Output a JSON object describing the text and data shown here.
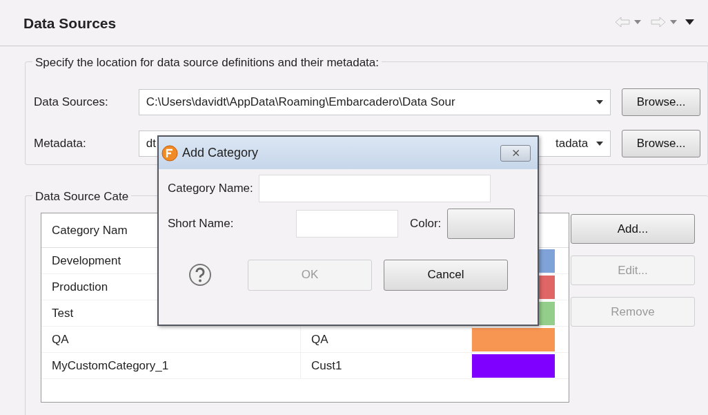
{
  "view": {
    "title": "Data Sources"
  },
  "locations": {
    "legend": "Specify the location for data source definitions and their metadata:",
    "fields": [
      {
        "label": "Data Sources:",
        "value_start": "C:\\Users\\davidt\\AppData\\Roaming\\Embarcadero\\Data Sour",
        "button": "Browse..."
      },
      {
        "label": "Metadata:",
        "value_start": "dt",
        "value_end": "tadata",
        "button": "Browse..."
      }
    ]
  },
  "categories": {
    "legend": "Data Source Cate",
    "columns": [
      "Category Nam"
    ],
    "rows": [
      {
        "name": "Development",
        "color": "#7fa3d8"
      },
      {
        "name": "Production",
        "color": "#e06666"
      },
      {
        "name": "Test",
        "color": "#93cf8a"
      },
      {
        "name": "QA",
        "short_name": "QA",
        "color": "#f79552"
      },
      {
        "name": "MyCustomCategory_1",
        "short_name": "Cust1",
        "color": "#8000ff"
      }
    ],
    "buttons": [
      {
        "label": "Add...",
        "disabled": false
      },
      {
        "label": "Edit...",
        "disabled": true
      },
      {
        "label": "Remove",
        "disabled": true
      }
    ]
  },
  "dialog": {
    "title": "Add Category",
    "close": "⨯",
    "name_label": "Category Name:",
    "short_label": "Short Name:",
    "color_label": "Color:",
    "buttons": [
      {
        "label": "OK",
        "disabled": true
      },
      {
        "label": "Cancel",
        "disabled": false
      }
    ]
  }
}
